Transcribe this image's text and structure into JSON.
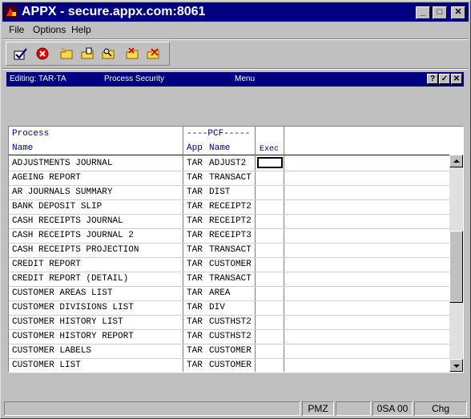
{
  "window": {
    "title": "APPX - secure.appx.com:8061"
  },
  "menu": {
    "items": [
      "File",
      "Options",
      "Help"
    ]
  },
  "toolbar": {
    "icons": [
      "check-icon",
      "cancel-icon",
      "new-folder-icon",
      "open-folder-icon",
      "search-folder-icon",
      "remove-folder-icon",
      "delete-folder-icon"
    ]
  },
  "subbar": {
    "editing": "Editing: TAR-TA",
    "section": "Process Security",
    "mode": "Menu",
    "help": "?",
    "ok": "✓",
    "close": "✕"
  },
  "table": {
    "header": {
      "process_top": "Process",
      "process_bottom": "Name",
      "pcf_top": "----PCF-----",
      "app": "App",
      "name": "Name",
      "exec": "Exec"
    },
    "rows": [
      {
        "process": "ADJUSTMENTS JOURNAL",
        "app": "TAR",
        "pcf": "ADJUST2"
      },
      {
        "process": "AGEING REPORT",
        "app": "TAR",
        "pcf": "TRANSACT"
      },
      {
        "process": "AR JOURNALS SUMMARY",
        "app": "TAR",
        "pcf": "DIST"
      },
      {
        "process": "BANK DEPOSIT SLIP",
        "app": "TAR",
        "pcf": "RECEIPT2"
      },
      {
        "process": "CASH RECEIPTS JOURNAL",
        "app": "TAR",
        "pcf": "RECEIPT2"
      },
      {
        "process": "CASH RECEIPTS JOURNAL 2",
        "app": "TAR",
        "pcf": "RECEIPT3"
      },
      {
        "process": "CASH RECEIPTS PROJECTION",
        "app": "TAR",
        "pcf": "TRANSACT"
      },
      {
        "process": "CREDIT REPORT",
        "app": "TAR",
        "pcf": "CUSTOMER"
      },
      {
        "process": "CREDIT REPORT (DETAIL)",
        "app": "TAR",
        "pcf": "TRANSACT"
      },
      {
        "process": "CUSTOMER AREAS LIST",
        "app": "TAR",
        "pcf": "AREA"
      },
      {
        "process": "CUSTOMER DIVISIONS LIST",
        "app": "TAR",
        "pcf": "DIV"
      },
      {
        "process": "CUSTOMER HISTORY LIST",
        "app": "TAR",
        "pcf": "CUSTHST2"
      },
      {
        "process": "CUSTOMER HISTORY REPORT",
        "app": "TAR",
        "pcf": "CUSTHST2"
      },
      {
        "process": "CUSTOMER LABELS",
        "app": "TAR",
        "pcf": "CUSTOMER"
      },
      {
        "process": "CUSTOMER LIST",
        "app": "TAR",
        "pcf": "CUSTOMER"
      }
    ]
  },
  "status": {
    "cells": [
      "PMZ",
      "",
      "0SA 00",
      "Chg"
    ]
  },
  "colors": {
    "title_bar": "#000080",
    "header_text": "#000080",
    "face": "#c0c0c0"
  }
}
